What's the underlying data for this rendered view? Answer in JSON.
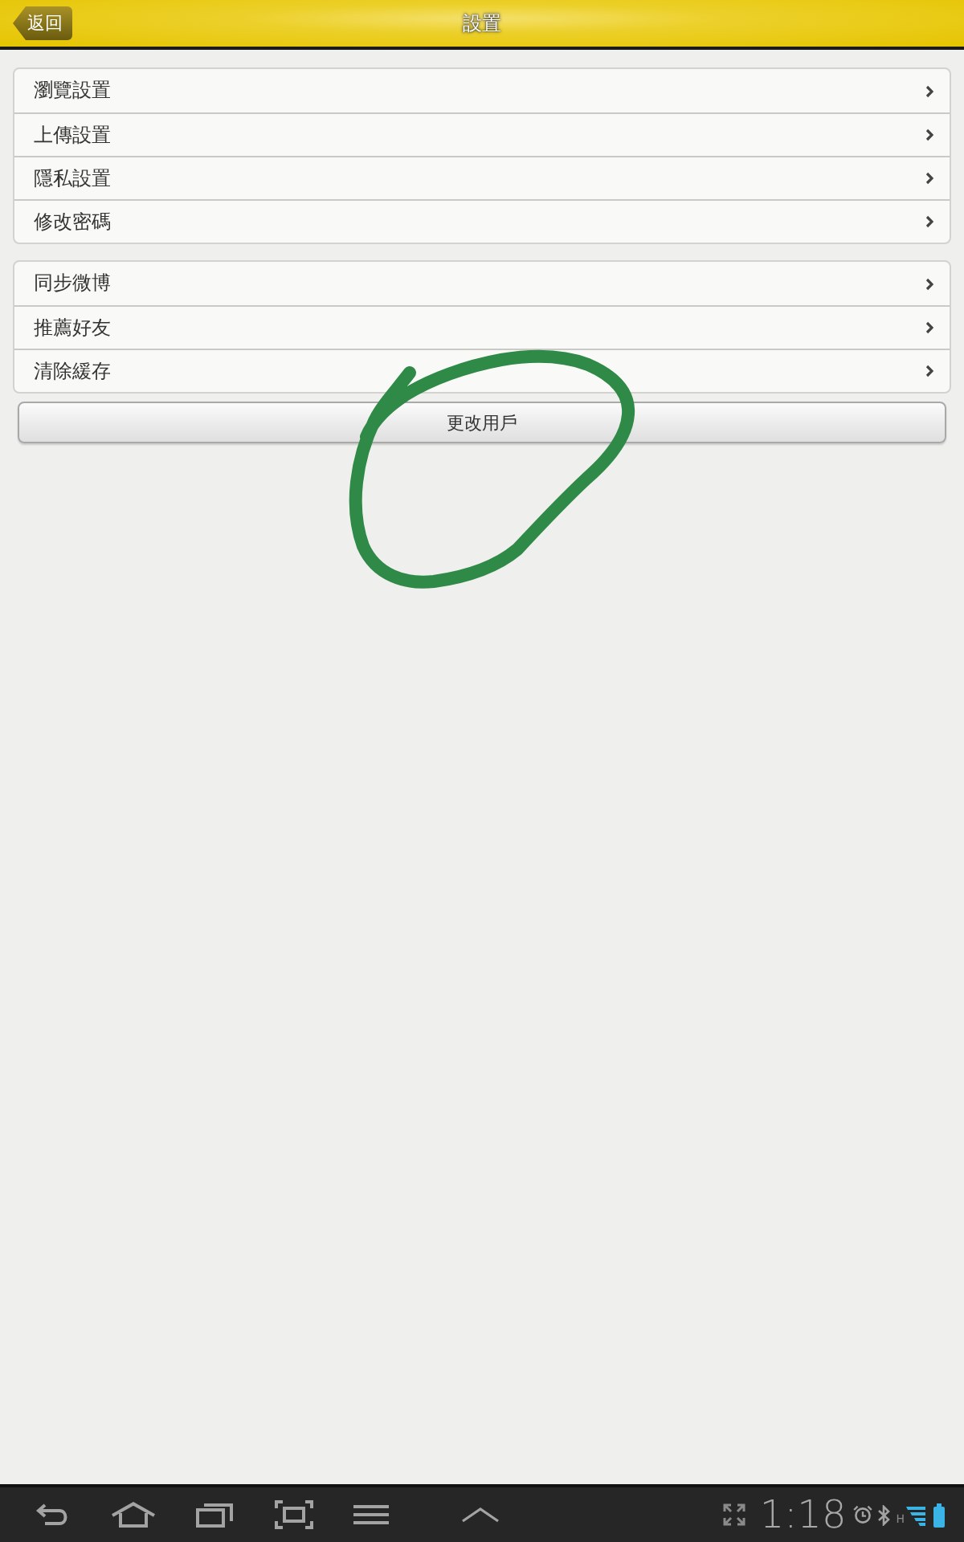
{
  "header": {
    "back_button": "返回",
    "title": "設置"
  },
  "groups": [
    {
      "items": [
        {
          "label": "瀏覽設置"
        },
        {
          "label": "上傳設置"
        },
        {
          "label": "隱私設置"
        },
        {
          "label": "修改密碼"
        }
      ]
    },
    {
      "items": [
        {
          "label": "同步微博"
        },
        {
          "label": "推薦好友"
        },
        {
          "label": "清除緩存"
        }
      ]
    }
  ],
  "switch_user_button": "更改用戶",
  "system_bar": {
    "time": "1:18",
    "network_type": "H"
  }
}
